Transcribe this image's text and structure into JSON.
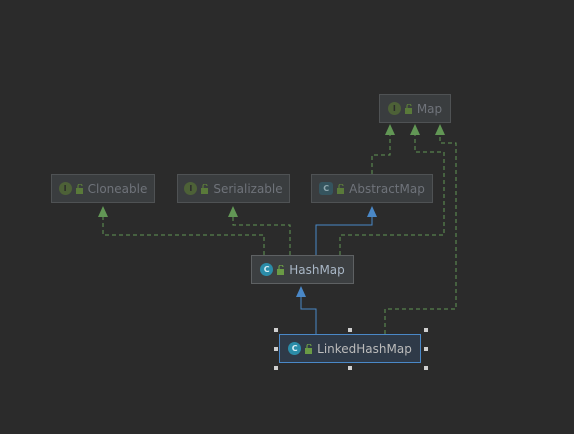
{
  "diagram": {
    "nodes": [
      {
        "id": "map",
        "label": "Map",
        "kind": "interface",
        "kind_letter": "I",
        "style": "muted"
      },
      {
        "id": "cloneable",
        "label": "Cloneable",
        "kind": "interface",
        "kind_letter": "I",
        "style": "muted"
      },
      {
        "id": "serializable",
        "label": "Serializable",
        "kind": "interface",
        "kind_letter": "I",
        "style": "muted"
      },
      {
        "id": "abstractmap",
        "label": "AbstractMap",
        "kind": "abstract-class",
        "kind_letter": "C",
        "style": "muted"
      },
      {
        "id": "hashmap",
        "label": "HashMap",
        "kind": "class",
        "kind_letter": "C",
        "style": "normal"
      },
      {
        "id": "linkedhashmap",
        "label": "LinkedHashMap",
        "kind": "class",
        "kind_letter": "C",
        "style": "selected"
      }
    ],
    "edges": [
      {
        "from": "abstractmap",
        "to": "map",
        "relation": "implements"
      },
      {
        "from": "hashmap",
        "to": "map",
        "relation": "implements"
      },
      {
        "from": "hashmap",
        "to": "cloneable",
        "relation": "implements"
      },
      {
        "from": "hashmap",
        "to": "serializable",
        "relation": "implements"
      },
      {
        "from": "hashmap",
        "to": "abstractmap",
        "relation": "extends"
      },
      {
        "from": "linkedhashmap",
        "to": "hashmap",
        "relation": "extends"
      },
      {
        "from": "linkedhashmap",
        "to": "map",
        "relation": "implements"
      }
    ],
    "colors": {
      "background": "#2b2b2b",
      "implements_edge": "#629755",
      "extends_edge": "#4a88c7",
      "selection_border": "#4a88c7"
    }
  }
}
